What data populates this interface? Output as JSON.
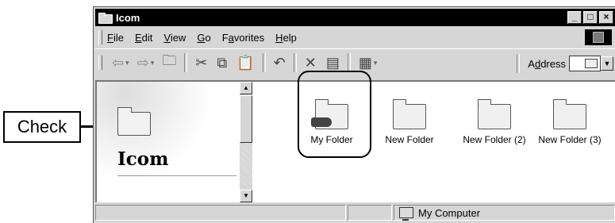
{
  "window": {
    "title": "Icom"
  },
  "menu": {
    "items": [
      {
        "label": "File",
        "u": "F",
        "rest": "ile"
      },
      {
        "label": "Edit",
        "u": "E",
        "rest": "dit"
      },
      {
        "label": "View",
        "u": "V",
        "rest": "iew"
      },
      {
        "label": "Go",
        "u": "G",
        "rest": "o"
      },
      {
        "label": "Favorites",
        "pre": "F",
        "u": "a",
        "rest": "vorites"
      },
      {
        "label": "Help",
        "u": "H",
        "rest": "elp"
      }
    ]
  },
  "toolbar": {
    "address_pre": "A",
    "address_u": "d",
    "address_rest": "dress"
  },
  "left_pane": {
    "title": "Icom"
  },
  "icons": [
    {
      "label": "My Folder"
    },
    {
      "label": "New Folder"
    },
    {
      "label": "New Folder (2)"
    },
    {
      "label": "New Folder (3)"
    }
  ],
  "status": {
    "location": "My Computer"
  },
  "callout": {
    "label": "Check"
  }
}
